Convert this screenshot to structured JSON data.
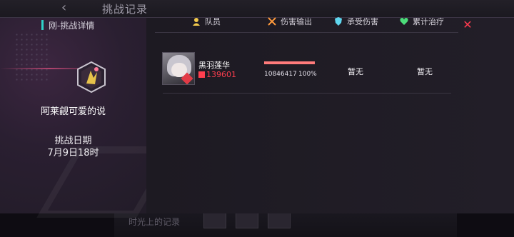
{
  "background": {
    "title": "挑战记录",
    "bottom_text": "时光上的记录"
  },
  "modal": {
    "title": "刚-挑战详情",
    "close_icon": "close-icon",
    "accent_color": "#2fd3c9",
    "close_color": "#ff3b4f"
  },
  "character": {
    "name": "阿莱觎可爱的说",
    "icon": "character-emblem-icon"
  },
  "challenge": {
    "date_label": "挑战日期",
    "date_value": "7月9日18时"
  },
  "table": {
    "headers": [
      {
        "label": "队员",
        "icon": "member-icon"
      },
      {
        "label": "伤害输出",
        "icon": "damage-icon"
      },
      {
        "label": "承受伤害",
        "icon": "shield-icon"
      },
      {
        "label": "累计治疗",
        "icon": "heal-icon"
      }
    ],
    "rows": [
      {
        "name": "黑羽莲华",
        "id": "139601",
        "damage": "10846417",
        "damage_pct": "100%",
        "damage_fraction": 1.0,
        "taken": "暂无",
        "heal": "暂无"
      }
    ]
  }
}
